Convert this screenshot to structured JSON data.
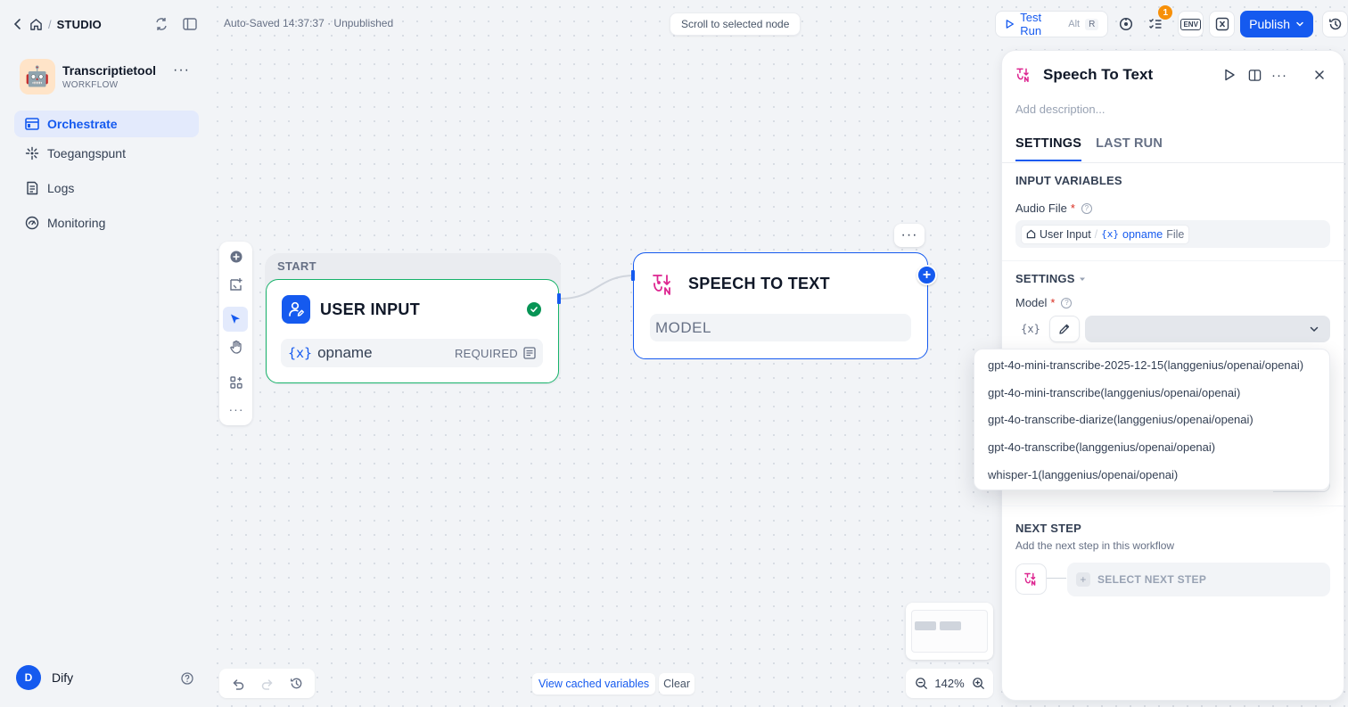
{
  "sidebar": {
    "breadcrumb": {
      "section": "STUDIO"
    },
    "app": {
      "name": "Transcriptietool",
      "type": "WORKFLOW",
      "icon": "robot"
    },
    "nav": [
      {
        "label": "Orchestrate",
        "icon": "orchestrate-icon",
        "active": true
      },
      {
        "label": "Toegangspunt",
        "icon": "access-point-icon",
        "active": false
      },
      {
        "label": "Logs",
        "icon": "logs-icon",
        "active": false
      },
      {
        "label": "Monitoring",
        "icon": "monitoring-icon",
        "active": false
      }
    ],
    "user": {
      "initial": "D",
      "name": "Dify"
    }
  },
  "header": {
    "autosave": "Auto-Saved 14:37:37 · Unpublished",
    "scroll_to_selected": "Scroll to selected node",
    "test_run": {
      "label": "Test Run",
      "shortcut_mod": "Alt",
      "shortcut_key": "R"
    },
    "checklist_badge": "1",
    "env_label": "ENV",
    "publish_label": "Publish"
  },
  "canvas": {
    "start_group_label": "START",
    "user_input_node": {
      "title": "USER INPUT",
      "var_symbol": "{x}",
      "var_name": "opname",
      "var_required": "REQUIRED"
    },
    "speech_node": {
      "title": "SPEECH TO TEXT",
      "model_placeholder": "MODEL"
    },
    "cached": {
      "view_label": "View cached variables",
      "clear_label": "Clear"
    },
    "zoom_level": "142%"
  },
  "panel": {
    "title": "Speech To Text",
    "description_placeholder": "Add description...",
    "tabs": [
      {
        "label": "SETTINGS",
        "active": true
      },
      {
        "label": "LAST RUN",
        "active": false
      }
    ],
    "input_variables": {
      "heading": "INPUT VARIABLES",
      "audio_file_label": "Audio File",
      "required_mark": "*",
      "audio_source": "User Input",
      "audio_var_symbol": "{x}",
      "audio_var_name": "opname",
      "audio_var_type": "File"
    },
    "settings": {
      "heading": "SETTINGS",
      "model_label": "Model",
      "var_toggle_symbol": "{x}",
      "model_options": [
        "gpt-4o-mini-transcribe-2025-12-15(langgenius/openai/openai)",
        "gpt-4o-mini-transcribe(langgenius/openai/openai)",
        "gpt-4o-transcribe-diarize(langgenius/openai/openai)",
        "gpt-4o-transcribe(langgenius/openai/openai)",
        "whisper-1(langgenius/openai/openai)"
      ]
    },
    "next_step": {
      "heading": "NEXT STEP",
      "subtitle": "Add the next step in this workflow",
      "select_label": "SELECT NEXT STEP"
    }
  },
  "colors": {
    "accent": "#155aef",
    "success": "#17b26a",
    "speech_icon": "#dd2590",
    "badge": "#f79009"
  }
}
